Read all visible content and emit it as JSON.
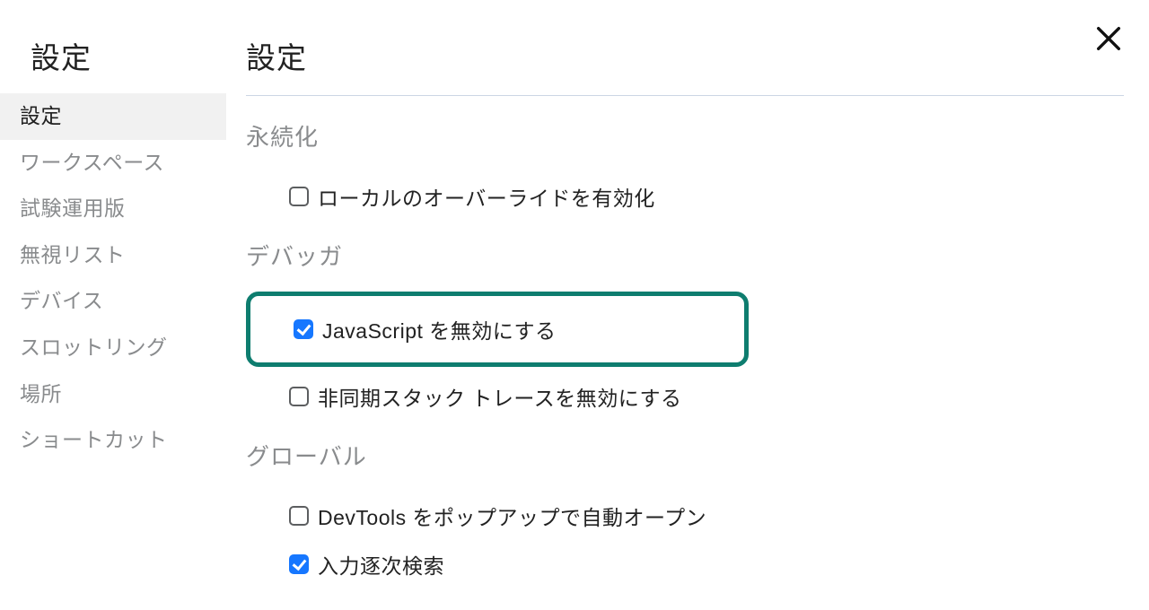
{
  "sidebar": {
    "title": "設定",
    "items": [
      {
        "label": "設定",
        "selected": true
      },
      {
        "label": "ワークスペース",
        "selected": false
      },
      {
        "label": "試験運用版",
        "selected": false
      },
      {
        "label": "無視リスト",
        "selected": false
      },
      {
        "label": "デバイス",
        "selected": false
      },
      {
        "label": "スロットリング",
        "selected": false
      },
      {
        "label": "場所",
        "selected": false
      },
      {
        "label": "ショートカット",
        "selected": false
      }
    ]
  },
  "main": {
    "title": "設定"
  },
  "sections": {
    "persistence": {
      "title": "永続化",
      "options": [
        {
          "key": "local_overrides",
          "label": "ローカルのオーバーライドを有効化",
          "checked": false
        }
      ]
    },
    "debugger": {
      "title": "デバッガ",
      "options": [
        {
          "key": "disable_js",
          "label": "JavaScript を無効にする",
          "checked": true,
          "highlighted": true
        },
        {
          "key": "disable_async",
          "label": "非同期スタック トレースを無効にする",
          "checked": false
        }
      ]
    },
    "global": {
      "title": "グローバル",
      "options": [
        {
          "key": "auto_open_devtools",
          "label": "DevTools をポップアップで自動オープン",
          "checked": false
        },
        {
          "key": "search_as_you_type",
          "label": "入力逐次検索",
          "checked": true
        }
      ]
    }
  },
  "colors": {
    "accent_checkbox": "#1677ff",
    "highlight_border": "#0e7d6f"
  }
}
